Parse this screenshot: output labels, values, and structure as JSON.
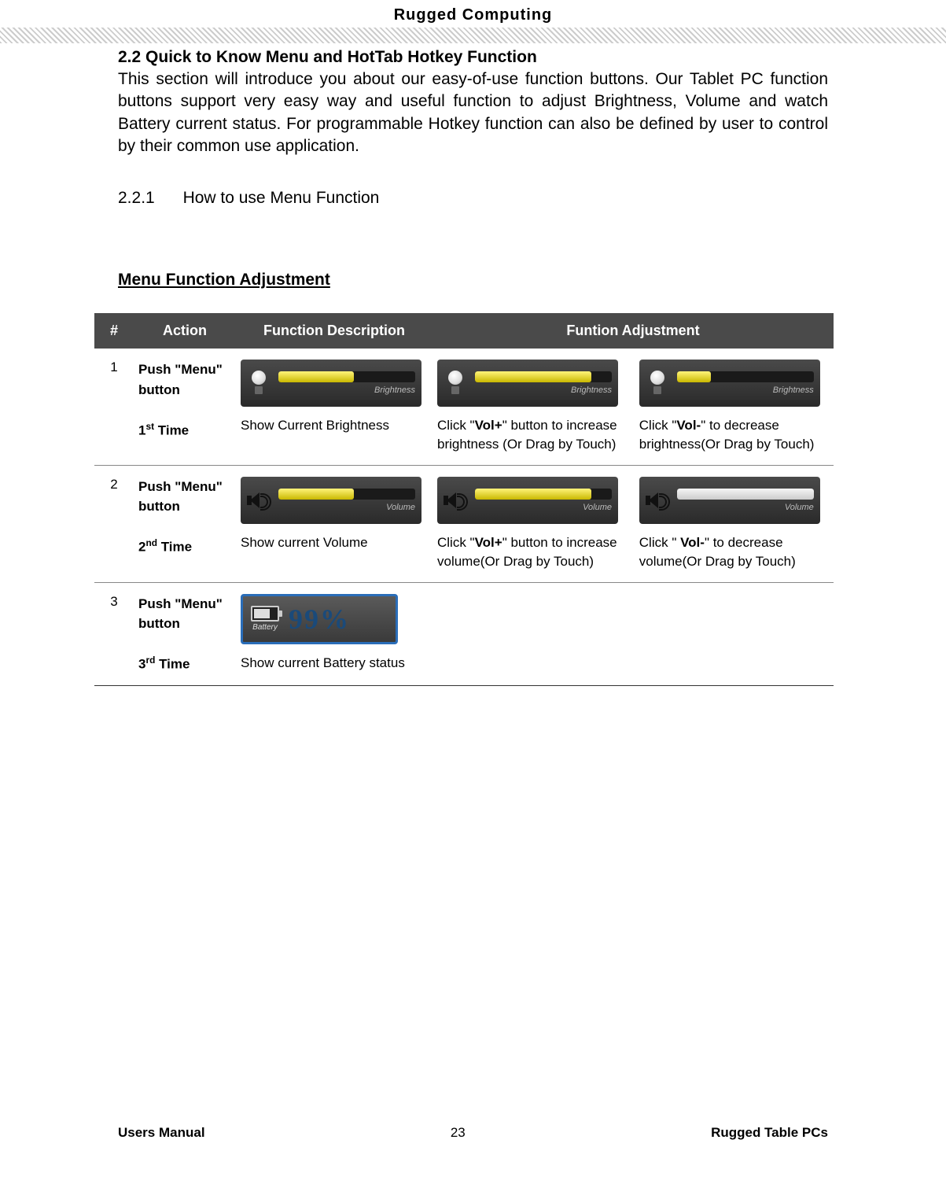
{
  "header": {
    "title": "Rugged Computing"
  },
  "section": {
    "number_title": "2.2 Quick to Know Menu and HotTab Hotkey Function",
    "intro": "This section will introduce you about our easy-of-use function buttons. Our Tablet PC function buttons support very easy way and useful function to adjust Brightness, Volume and watch Battery current status. For programmable Hotkey function can also be defined by user to control by their common use application."
  },
  "subsection": {
    "number": "2.2.1",
    "title": "How to use Menu Function"
  },
  "table": {
    "title": "Menu Function Adjustment",
    "headers": {
      "num": "#",
      "action": "Action",
      "func": "Function Description",
      "adj": "Funtion Adjustment"
    },
    "rows": [
      {
        "num": "1",
        "action_line1": "Push \"Menu\" button",
        "action_line2_prefix": "1",
        "action_line2_sup": "st",
        "action_line2_suffix": " Time",
        "osd_label": "Brightness",
        "func_desc": "Show Current Brightness",
        "adj1_pre": "Click \"",
        "adj1_bold": "Vol+",
        "adj1_post": "\" button to increase brightness (Or Drag by Touch)",
        "adj2_pre": "Click \"",
        "adj2_bold": "Vol-",
        "adj2_post": "\" to decrease brightness(Or Drag by Touch)"
      },
      {
        "num": "2",
        "action_line1": "Push \"Menu\" button",
        "action_line2_prefix": "2",
        "action_line2_sup": "nd",
        "action_line2_suffix": " Time",
        "osd_label": "Volume",
        "func_desc": "Show current Volume",
        "adj1_pre": "Click \"",
        "adj1_bold": "Vol+",
        "adj1_post": "\" button to increase volume(Or Drag by Touch)",
        "adj2_pre": "Click \" ",
        "adj2_bold": "Vol-",
        "adj2_post": "\" to decrease volume(Or Drag by Touch)"
      },
      {
        "num": "3",
        "action_line1": "Push \"Menu\" button",
        "action_line2_prefix": "3",
        "action_line2_sup": "rd",
        "action_line2_suffix": "  Time",
        "battery_label": "Battery",
        "battery_pct": "99%",
        "func_desc": "Show current Battery status"
      }
    ]
  },
  "footer": {
    "left": "Users Manual",
    "page": "23",
    "right": "Rugged Table PCs"
  }
}
